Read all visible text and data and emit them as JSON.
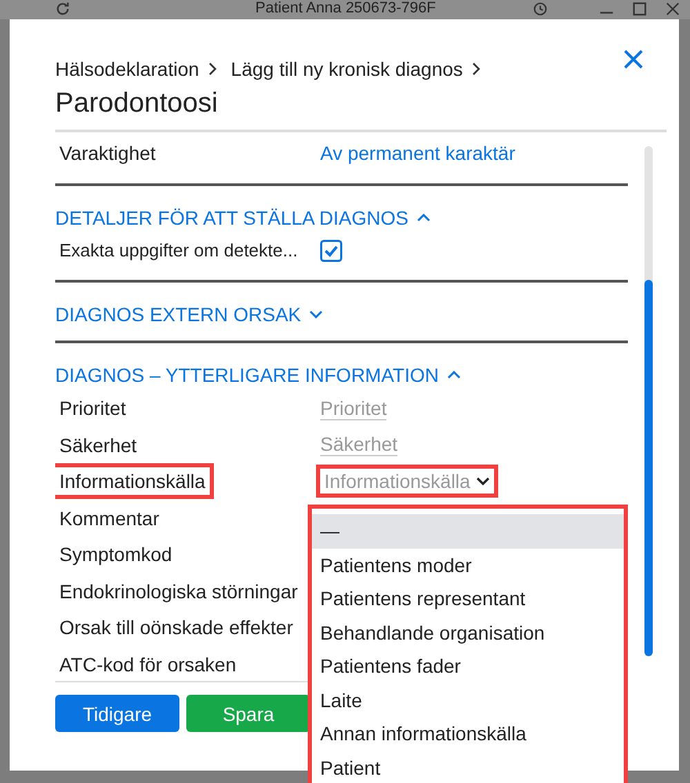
{
  "app_window": {
    "title": "Patient Anna 250673-796F"
  },
  "dialog": {
    "breadcrumb": [
      "Hälsodeklaration",
      "Lägg till ny kronisk diagnos"
    ],
    "title": "Parodontoosi",
    "rows": [
      {
        "kind": "link_field",
        "label": "Varaktighet",
        "value": "Av permanent karaktär",
        "highlighted": false
      },
      {
        "kind": "section",
        "title": "DETALJER FÖR ATT STÄLLA DIAGNOS",
        "expanded": true
      },
      {
        "kind": "checkbox",
        "label": "Exakta uppgifter om detekte...",
        "checked": true
      },
      {
        "kind": "section",
        "title": "DIAGNOS EXTERN ORSAK",
        "expanded": false
      },
      {
        "kind": "section",
        "title": "DIAGNOS – YTTERLIGARE INFORMATION",
        "expanded": true
      },
      {
        "kind": "text_field",
        "label": "Prioritet",
        "value": "Prioritet",
        "highlighted": false
      },
      {
        "kind": "text_field",
        "label": "Säkerhet",
        "value": "Säkerhet",
        "highlighted": false
      },
      {
        "kind": "select_field",
        "label": "Informationskälla",
        "value": "Informationskälla",
        "highlighted": true
      },
      {
        "kind": "field",
        "label": "Kommentar",
        "highlighted": false
      },
      {
        "kind": "field",
        "label": "Symptomkod",
        "highlighted": false
      },
      {
        "kind": "field",
        "label": "Endokrinologiska störningar",
        "highlighted": false
      },
      {
        "kind": "field",
        "label": "Orsak till oönskade effekter",
        "highlighted": false
      },
      {
        "kind": "field",
        "label": "ATC-kod för orsaken",
        "highlighted": false
      }
    ],
    "buttons": [
      {
        "label": "Tidigare",
        "kind": "primary"
      },
      {
        "label": "Spara",
        "kind": "success"
      }
    ]
  },
  "dropdown": {
    "highlighted": true,
    "options": [
      {
        "label": "—",
        "selected": true
      },
      {
        "label": "Patientens moder",
        "selected": false
      },
      {
        "label": "Patientens representant",
        "selected": false
      },
      {
        "label": "Behandlande organisation",
        "selected": false
      },
      {
        "label": "Patientens fader",
        "selected": false
      },
      {
        "label": "Laite",
        "selected": false
      },
      {
        "label": "Annan informationskälla",
        "selected": false
      },
      {
        "label": "Patient",
        "selected": false
      }
    ]
  }
}
